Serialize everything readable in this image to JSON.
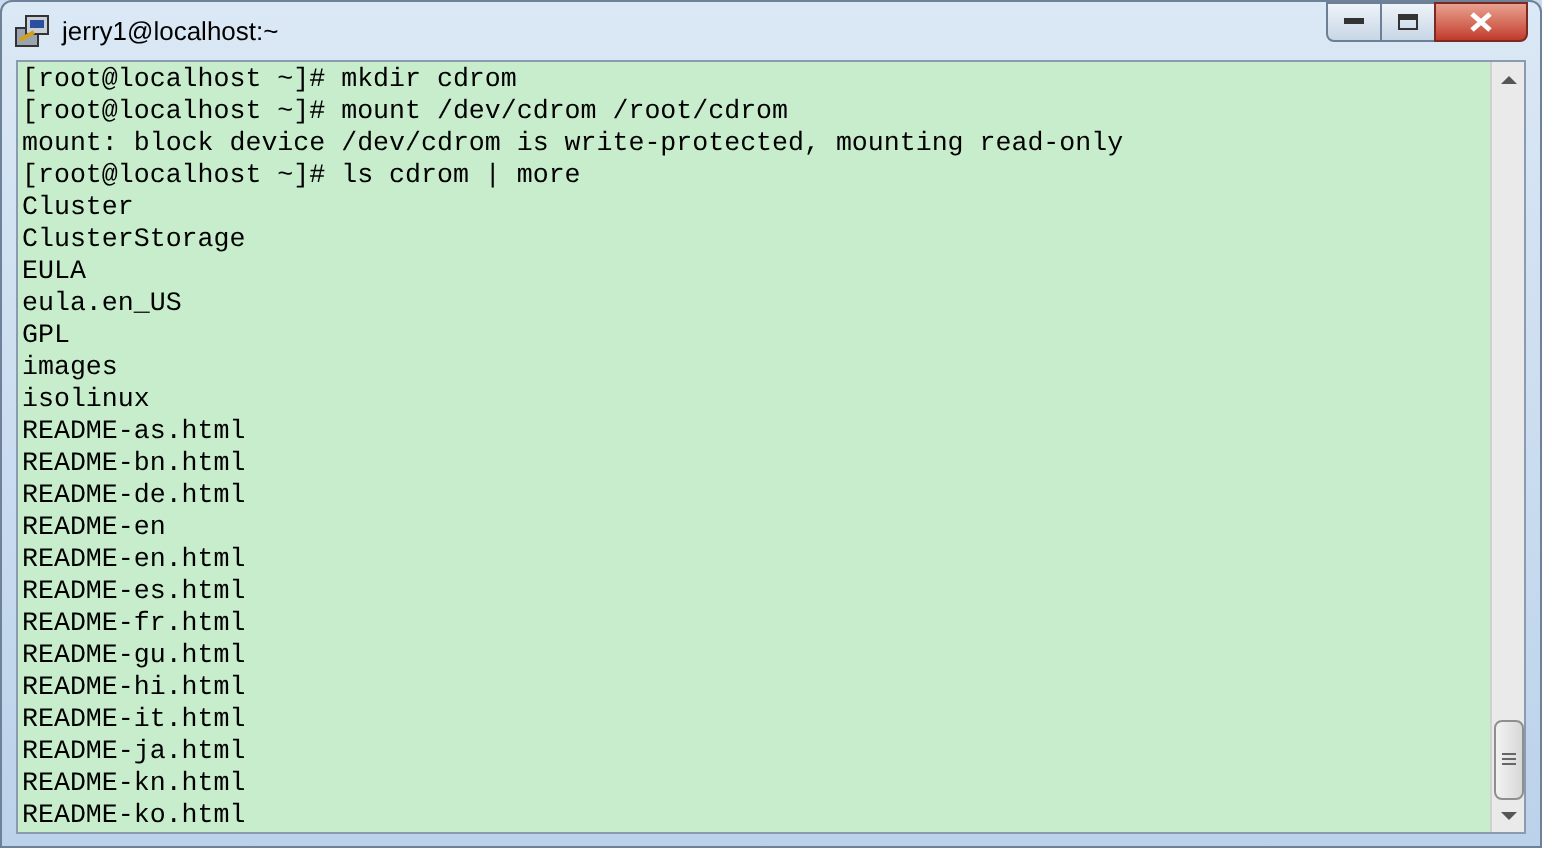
{
  "window": {
    "title": "jerry1@localhost:~"
  },
  "terminal": {
    "lines": [
      "[root@localhost ~]# mkdir cdrom",
      "[root@localhost ~]# mount /dev/cdrom /root/cdrom",
      "mount: block device /dev/cdrom is write-protected, mounting read-only",
      "[root@localhost ~]# ls cdrom | more",
      "Cluster",
      "ClusterStorage",
      "EULA",
      "eula.en_US",
      "GPL",
      "images",
      "isolinux",
      "README-as.html",
      "README-bn.html",
      "README-de.html",
      "README-en",
      "README-en.html",
      "README-es.html",
      "README-fr.html",
      "README-gu.html",
      "README-hi.html",
      "README-it.html",
      "README-ja.html",
      "README-kn.html",
      "README-ko.html"
    ]
  }
}
